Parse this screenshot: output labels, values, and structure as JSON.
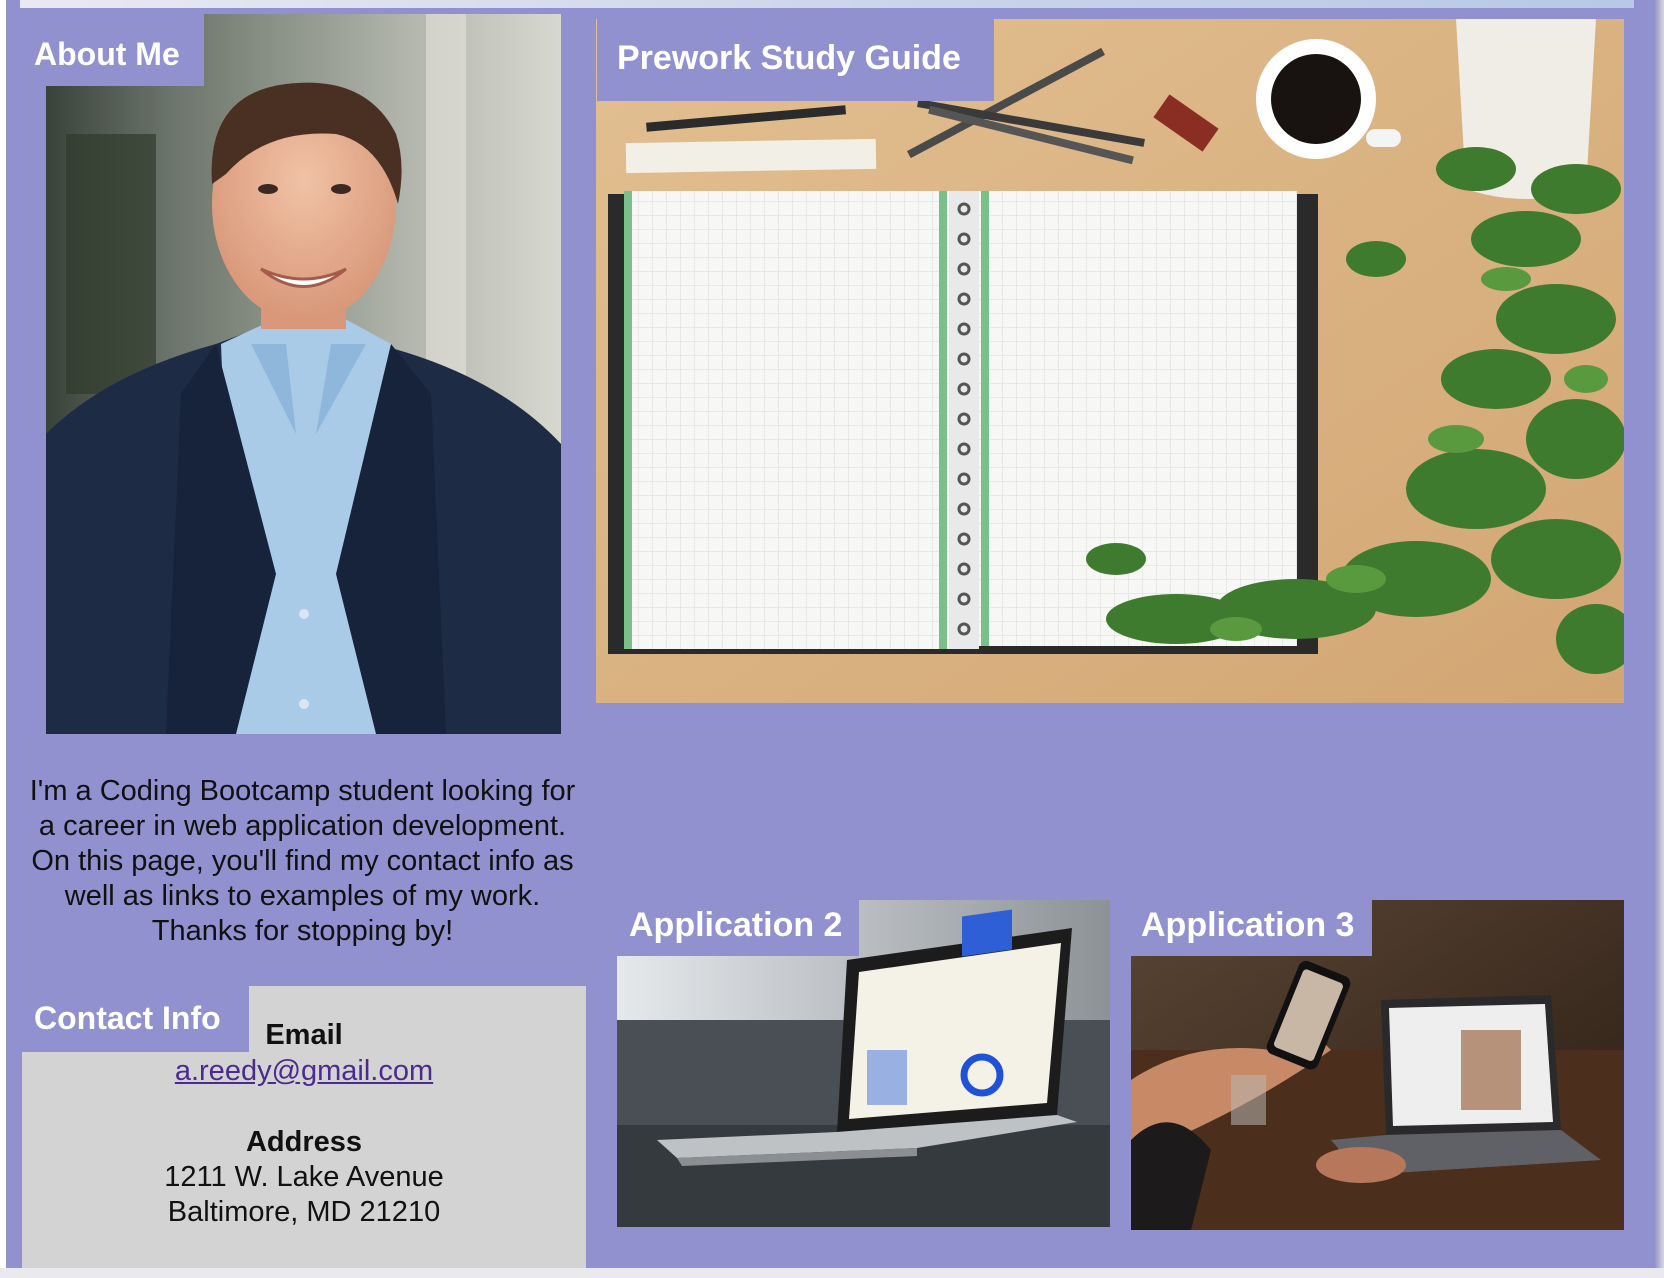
{
  "about": {
    "title": "About Me",
    "bio": "I'm a Coding Bootcamp student looking for a career in web application development. On this page, you'll find my contact info as well as links to examples of my work. Thanks for stopping by!"
  },
  "contact": {
    "title": "Contact Info",
    "email_label": "Email",
    "email": "a.reedy@gmail.com",
    "address_label": "Address",
    "address_line1": "1211 W. Lake Avenue",
    "address_line2": "Baltimore, MD 21210"
  },
  "projects": {
    "prework_title": "Prework Study Guide",
    "app2_title": "Application 2",
    "app3_title": "Application 3"
  },
  "colors": {
    "page_background": "#9191d0",
    "contact_background": "#d3d3d3",
    "title_text": "#ffffff",
    "link": "#4b2b8f"
  }
}
